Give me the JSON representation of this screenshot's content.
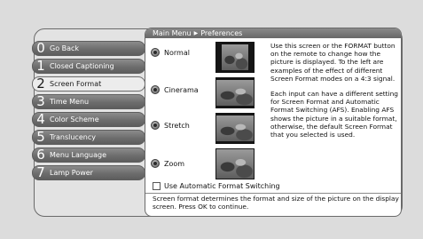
{
  "breadcrumb": {
    "root": "Main Menu",
    "current": "Preferences"
  },
  "menu": {
    "items": [
      {
        "number": "0",
        "label": "Go Back"
      },
      {
        "number": "1",
        "label": "Closed Captioning"
      },
      {
        "number": "2",
        "label": "Screen Format",
        "selected": true
      },
      {
        "number": "3",
        "label": "Time Menu"
      },
      {
        "number": "4",
        "label": "Color Scheme"
      },
      {
        "number": "5",
        "label": "Translucency"
      },
      {
        "number": "6",
        "label": "Menu Language"
      },
      {
        "number": "7",
        "label": "Lamp Power"
      }
    ]
  },
  "format_options": [
    {
      "label": "Normal"
    },
    {
      "label": "Cinerama"
    },
    {
      "label": "Stretch"
    },
    {
      "label": "Zoom"
    }
  ],
  "help": {
    "para1": "Use this screen or the FORMAT button on the remote to change how the picture is displayed. To the left are examples of the effect of different Screen Format modes on a 4:3 signal.",
    "para2": "Each input can have a different setting for Screen Format and Automatic Format Switching (AFS). Enabling AFS shows the picture in a suitable format, otherwise, the default Screen Format that you selected is used."
  },
  "afs_checkbox": {
    "label": "Use Automatic Format Switching",
    "checked": false
  },
  "status": {
    "text": "Screen format determines the format and size of the picture on the display screen. Press OK to continue."
  },
  "colors": {
    "background": "#dcdcdc",
    "menu_button": "#6d6d6d",
    "menu_selected": "#ececec",
    "breadcrumb_bar": "#777777",
    "content_bg": "#ffffff"
  }
}
